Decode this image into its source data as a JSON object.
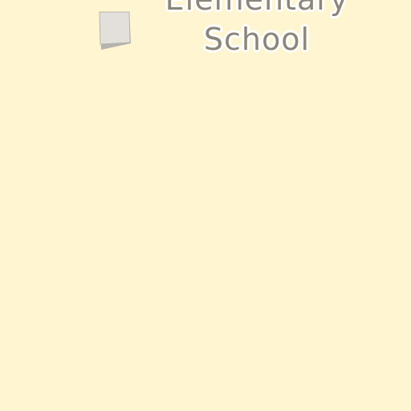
{
  "map": {
    "background_color": "#fff5d1",
    "poi_label": {
      "line1": "Elementary",
      "line2": "School",
      "color": "#8c867a"
    },
    "building_icon": {
      "name": "building-icon",
      "fill": "#e3e0dc",
      "stroke": "#b6b3ae"
    }
  }
}
